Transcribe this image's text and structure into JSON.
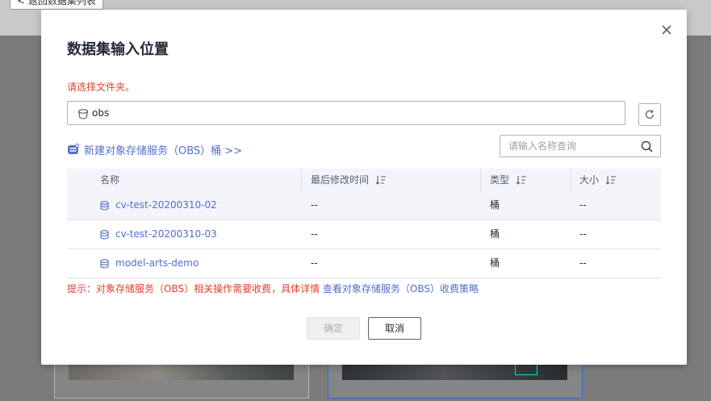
{
  "background": {
    "back_button_label": "< 返回数据集列表"
  },
  "modal": {
    "title": "数据集输入位置",
    "error_hint": "请选择文件夹。",
    "path_value": "obs",
    "create_link_label": "新建对象存储服务（OBS）桶 >>",
    "search_placeholder": "请输入名称查询",
    "table": {
      "headers": {
        "name": "名称",
        "modified": "最后修改时间",
        "type": "类型",
        "size": "大小"
      },
      "rows": [
        {
          "name": "cv-test-20200310-02",
          "modified": "--",
          "type": "桶",
          "size": "--"
        },
        {
          "name": "cv-test-20200310-03",
          "modified": "--",
          "type": "桶",
          "size": "--"
        },
        {
          "name": "model-arts-demo",
          "modified": "--",
          "type": "桶",
          "size": "--"
        }
      ]
    },
    "tip_text": "提示：对象存储服务（OBS）相关操作需要收费，具体详情",
    "tip_link": " 查看对象存储服务（OBS）收费策略",
    "ok_label": "确定",
    "cancel_label": "取消"
  },
  "colors": {
    "accent": "#526ecc",
    "error": "#e0432f"
  }
}
